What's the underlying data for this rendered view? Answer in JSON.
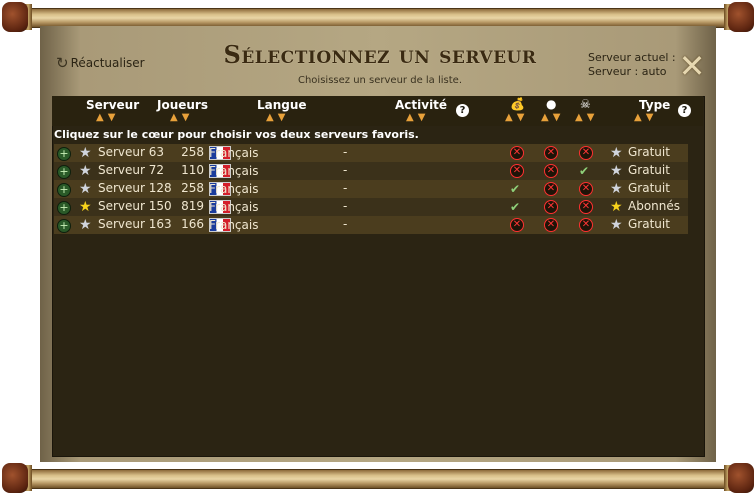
{
  "header": {
    "refresh_label": "Réactualiser",
    "title": "Sélectionnez un serveur",
    "subtitle": "Choisissez un serveur de la liste.",
    "current_label": "Serveur actuel :",
    "current_value": "Serveur : auto"
  },
  "columns": {
    "server": "Serveur",
    "players": "Joueurs",
    "language": "Langue",
    "activity": "Activité",
    "type": "Type",
    "money_icon": "money-bag-icon",
    "chat_icon": "chat-icon",
    "pvp_icon": "skull-icon"
  },
  "hint": "Cliquez sur le cœur pour choisir vos deux serveurs favoris.",
  "rows": [
    {
      "name": "Serveur 63",
      "players": "258",
      "language": "Français",
      "activity": "-",
      "members": false,
      "lootshare": false,
      "pvp": false,
      "type": "Gratuit",
      "star": "silver"
    },
    {
      "name": "Serveur 72",
      "players": "110",
      "language": "Français",
      "activity": "-",
      "members": false,
      "lootshare": false,
      "pvp": true,
      "type": "Gratuit",
      "star": "silver"
    },
    {
      "name": "Serveur 128",
      "players": "258",
      "language": "Français",
      "activity": "-",
      "members": true,
      "lootshare": false,
      "pvp": false,
      "type": "Gratuit",
      "star": "silver"
    },
    {
      "name": "Serveur 150",
      "players": "819",
      "language": "Français",
      "activity": "-",
      "members": true,
      "lootshare": false,
      "pvp": false,
      "type": "Abonnés",
      "star": "gold"
    },
    {
      "name": "Serveur 163",
      "players": "166",
      "language": "Français",
      "activity": "-",
      "members": false,
      "lootshare": false,
      "pvp": false,
      "type": "Gratuit",
      "star": "silver"
    }
  ],
  "colors": {
    "panel": "#2b2413",
    "row_odd": "#4b3d1e",
    "row_even": "#3b311a",
    "yes": "#8fd17a",
    "no": "#ff3030"
  }
}
